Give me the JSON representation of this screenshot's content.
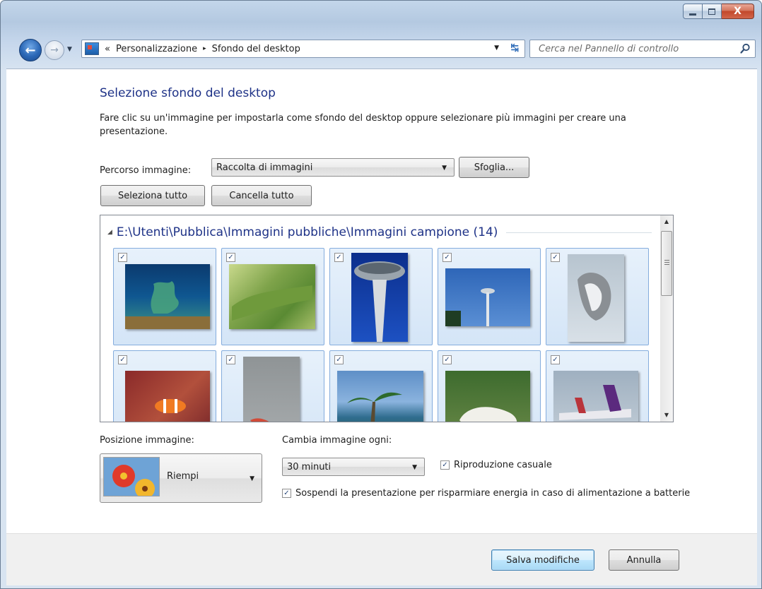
{
  "window": {
    "min_label": "",
    "max_label": "",
    "close_label": "X"
  },
  "nav": {
    "back_symbol": "←",
    "forward_symbol": "→",
    "address_chevron": "«",
    "breadcrumbs": [
      "Personalizzazione",
      "Sfondo del desktop"
    ],
    "crumb_separator": "▸",
    "search_placeholder": "Cerca nel Pannello di controllo"
  },
  "main": {
    "title": "Selezione sfondo del desktop",
    "description": "Fare clic su un'immagine per impostarla come sfondo del desktop oppure selezionare più immagini per creare una presentazione.",
    "path_label": "Percorso immagine:",
    "path_value": "Raccolta di immagini",
    "browse_label": "Sfoglia...",
    "select_all_label": "Seleziona tutto",
    "clear_all_label": "Cancella tutto"
  },
  "gallery": {
    "group_title": "E:\\Utenti\\Pubblica\\Immagini pubbliche\\Immagini campione (14)",
    "check_mark": "✓",
    "tiles": [
      {
        "icon": "coral-reef-thumbnail",
        "checked": true
      },
      {
        "icon": "green-leaf-thumbnail",
        "checked": true
      },
      {
        "icon": "space-needle-closeup-thumbnail",
        "checked": true
      },
      {
        "icon": "space-needle-sky-thumbnail",
        "checked": true
      },
      {
        "icon": "wolf-in-snow-thumbnail",
        "checked": true
      },
      {
        "icon": "clownfish-thumbnail",
        "checked": true
      },
      {
        "icon": "kayak-thumbnail",
        "checked": true
      },
      {
        "icon": "palm-coast-thumbnail",
        "checked": true
      },
      {
        "icon": "white-dog-thumbnail",
        "checked": true
      },
      {
        "icon": "airplanes-thumbnail",
        "checked": true
      }
    ]
  },
  "position": {
    "label": "Posizione immagine:",
    "value": "Riempi"
  },
  "interval": {
    "label": "Cambia immagine ogni:",
    "value": "30 minuti"
  },
  "options": {
    "shuffle_label": "Riproduzione casuale",
    "shuffle_checked": true,
    "battery_label": "Sospendi la presentazione per risparmiare energia in caso di alimentazione a batterie",
    "battery_checked": true
  },
  "footer": {
    "save_label": "Salva modifiche",
    "cancel_label": "Annulla"
  },
  "colors": {
    "title_blue": "#1e3287",
    "tile_border": "#84acdd",
    "chrome_blue": "#b4c9e1"
  }
}
